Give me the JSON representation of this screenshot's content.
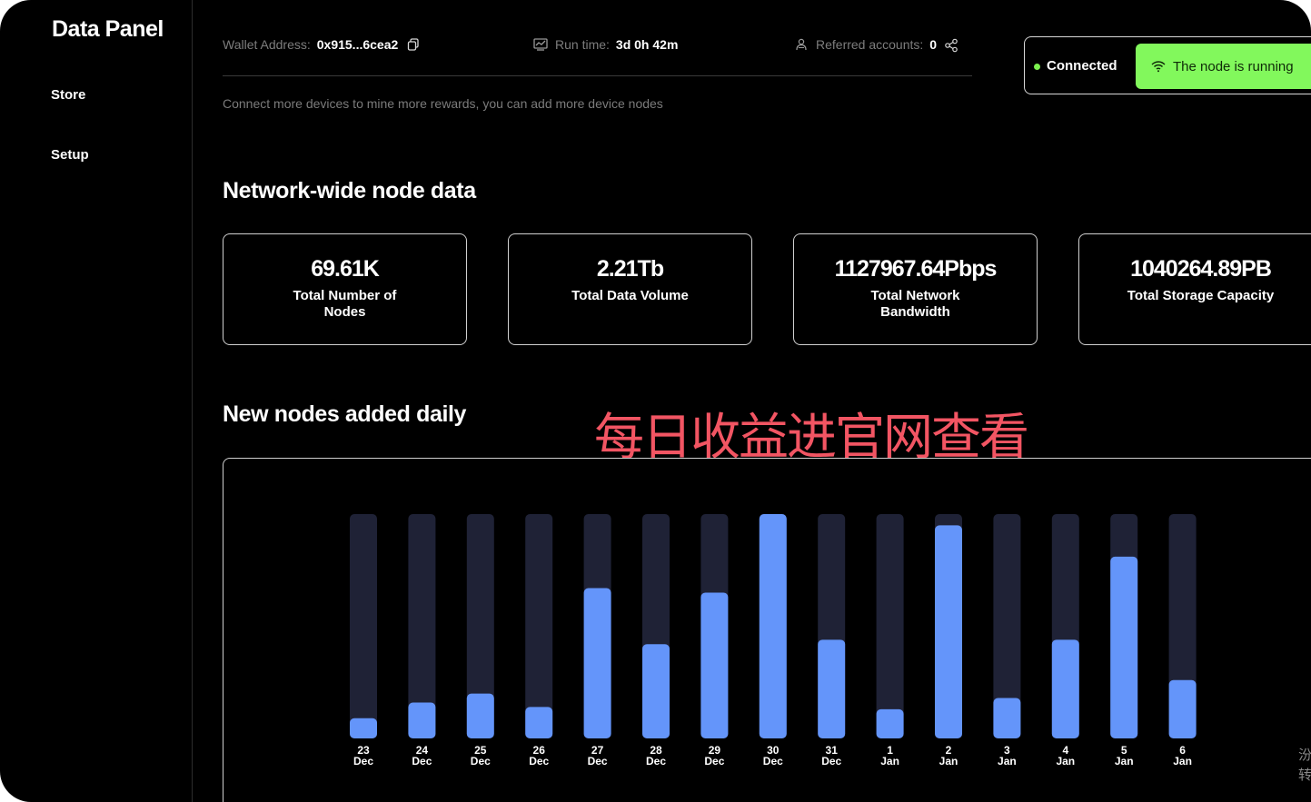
{
  "sidebar": {
    "title": "Data Panel",
    "items": [
      {
        "label": "Store"
      },
      {
        "label": "Setup"
      }
    ]
  },
  "topbar": {
    "wallet": {
      "label": "Wallet Address:",
      "value": "0x915...6cea2",
      "icon": "copy-icon"
    },
    "runtime": {
      "label": "Run time:",
      "value": "3d 0h 42m",
      "icon": "chart-icon"
    },
    "referred": {
      "label": "Referred accounts:",
      "value": "0",
      "icon": "people-icon",
      "action_icon": "share-icon"
    },
    "hint": "Connect more devices to mine more rewards, you can add more device nodes"
  },
  "status": {
    "connection": "Connected",
    "node_button": "The node is running",
    "dot_color": "#7cf04e",
    "button_color": "#82f85c"
  },
  "network": {
    "title": "Network-wide node data",
    "cards": [
      {
        "value": "69.61K",
        "label": "Total Number of Nodes"
      },
      {
        "value": "2.21Tb",
        "label": "Total Data Volume"
      },
      {
        "value": "1127967.64Pbps",
        "label": "Total Network Bandwidth"
      },
      {
        "value": "1040264.89PB",
        "label": "Total Storage Capacity"
      }
    ]
  },
  "daily": {
    "title": "New nodes added daily"
  },
  "overlay_text": "每日收益进官网查看",
  "watermark": "汾转",
  "colors": {
    "bar_fill": "#6495fa",
    "bar_track": "#1f2236",
    "overlay": "#f25563"
  },
  "chart_data": {
    "type": "bar",
    "categories": [
      [
        "23",
        "Dec"
      ],
      [
        "24",
        "Dec"
      ],
      [
        "25",
        "Dec"
      ],
      [
        "26",
        "Dec"
      ],
      [
        "27",
        "Dec"
      ],
      [
        "28",
        "Dec"
      ],
      [
        "29",
        "Dec"
      ],
      [
        "30",
        "Dec"
      ],
      [
        "31",
        "Dec"
      ],
      [
        "1",
        "Jan"
      ],
      [
        "2",
        "Jan"
      ],
      [
        "3",
        "Jan"
      ],
      [
        "4",
        "Jan"
      ],
      [
        "5",
        "Jan"
      ],
      [
        "6",
        "Jan"
      ]
    ],
    "values": [
      0.09,
      0.16,
      0.2,
      0.14,
      0.67,
      0.42,
      0.65,
      1.0,
      0.44,
      0.13,
      0.95,
      0.18,
      0.44,
      0.81,
      0.26
    ],
    "value_unit": "fraction of maximum (no axis printed)",
    "title": "New nodes added daily",
    "xlabel": "",
    "ylabel": "",
    "ylim": [
      0,
      1
    ],
    "grid": false,
    "legend": "none"
  }
}
